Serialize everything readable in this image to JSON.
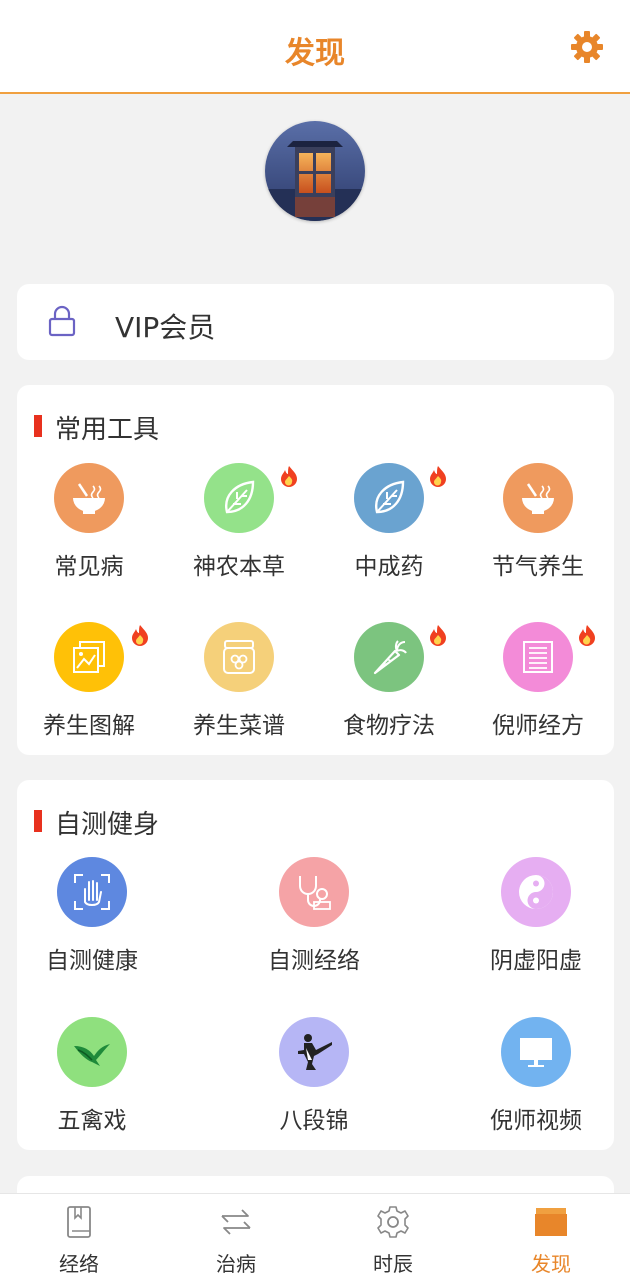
{
  "header": {
    "title": "发现"
  },
  "vip": {
    "label": "VIP会员"
  },
  "tools_section": {
    "title": "常用工具",
    "items": [
      {
        "label": "常见病",
        "icon": "bowl-icon",
        "color": "#ef9a5e",
        "hot": false
      },
      {
        "label": "神农本草",
        "icon": "herb-leaf-icon",
        "color": "#94e28a",
        "hot": true
      },
      {
        "label": "中成药",
        "icon": "leaf-icon",
        "color": "#6aa3d0",
        "hot": true
      },
      {
        "label": "节气养生",
        "icon": "bowl-icon",
        "color": "#ef9a5e",
        "hot": false
      },
      {
        "label": "养生图解",
        "icon": "picture-icon",
        "color": "#ffc107",
        "hot": true
      },
      {
        "label": "养生菜谱",
        "icon": "jar-icon",
        "color": "#f5d07a",
        "hot": false
      },
      {
        "label": "食物疗法",
        "icon": "carrot-icon",
        "color": "#7cc47f",
        "hot": true
      },
      {
        "label": "倪师经方",
        "icon": "document-icon",
        "color": "#f38bd8",
        "hot": true
      }
    ]
  },
  "fitness_section": {
    "title": "自测健身",
    "items": [
      {
        "label": "自测健康",
        "icon": "hand-scan-icon",
        "color": "#5e88e0"
      },
      {
        "label": "自测经络",
        "icon": "stethoscope-icon",
        "color": "#f5a3a6"
      },
      {
        "label": "阴虚阳虚",
        "icon": "yin-yang-icon",
        "color": "#e6aef2"
      },
      {
        "label": "五禽戏",
        "icon": "bird-icon",
        "color": "#8fe07e"
      },
      {
        "label": "八段锦",
        "icon": "martial-arts-icon",
        "color": "#b6b6f5"
      },
      {
        "label": "倪师视频",
        "icon": "monitor-icon",
        "color": "#72b3f0"
      }
    ]
  },
  "tabbar": {
    "tabs": [
      {
        "label": "经络",
        "icon": "book-icon"
      },
      {
        "label": "治病",
        "icon": "arrows-icon"
      },
      {
        "label": "时辰",
        "icon": "gear-icon"
      },
      {
        "label": "发现",
        "icon": "folder-icon"
      }
    ],
    "active_index": 3,
    "active_color": "#e8862a"
  },
  "colors": {
    "accent": "#e8862a",
    "section_marker": "#e8311e"
  }
}
